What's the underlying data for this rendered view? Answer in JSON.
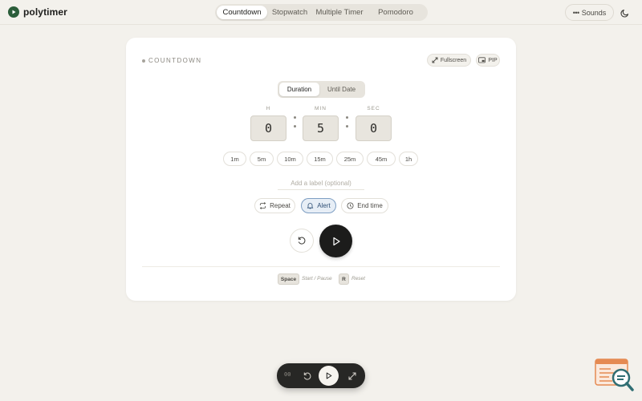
{
  "app": {
    "name": "polytimer"
  },
  "nav": {
    "tabs": [
      {
        "label": "Countdown",
        "active": true
      },
      {
        "label": "Stopwatch",
        "active": false
      },
      {
        "label": "Multiple Timer",
        "active": false
      },
      {
        "label": "Pomodoro",
        "active": false
      }
    ]
  },
  "header": {
    "sounds_label": "Sounds",
    "theme_icon": "moon-icon"
  },
  "timer": {
    "section_label": "COUNTDOWN",
    "fullscreen_label": "Fullscreen",
    "pip_label": "PIP",
    "modes": [
      "Duration",
      "Until Date"
    ],
    "active_mode": "Duration",
    "units": {
      "hours": "H",
      "minutes": "MIN",
      "seconds": "SEC"
    },
    "values": {
      "hours": "0",
      "minutes": "5",
      "seconds": "0"
    },
    "presets": [
      "1m",
      "5m",
      "10m",
      "15m",
      "25m",
      "45m",
      "1h"
    ],
    "label_placeholder": "Add a label (optional)",
    "options": [
      {
        "label": "Repeat",
        "icon": "repeat-icon",
        "active": false
      },
      {
        "label": "Alert",
        "icon": "bell-icon",
        "active": true
      },
      {
        "label": "End time",
        "icon": "clock-icon",
        "active": false
      }
    ],
    "shortcuts": [
      {
        "key": "Space",
        "desc": "Start / Pause"
      },
      {
        "key": "R",
        "desc": "Reset"
      }
    ]
  },
  "mini_bar": {
    "time": "00"
  },
  "colors": {
    "accent": "#2b5d3a",
    "active_option_bg": "#e7eef6",
    "play_button": "#1c1c1b"
  }
}
